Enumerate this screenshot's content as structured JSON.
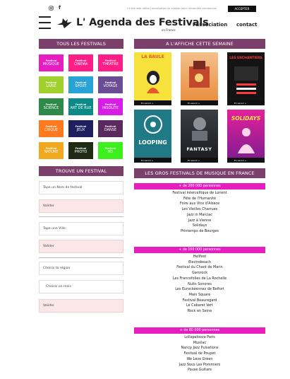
{
  "topbar": {
    "social_icons": [
      "instagram-icon",
      "facebook-icon"
    ],
    "cookie_text": "Ce site web utilise l'autorisation de cookies pour l'ensemble commercial",
    "accept_label": "ACCEPTER"
  },
  "header": {
    "logo_text": "L' Agenda des Festivals",
    "logo_sub": "en France",
    "nav_association": "l'association",
    "nav_contact": "contact"
  },
  "sections": {
    "all_festivals": "TOUS LES FESTIVALS",
    "affiche": "A L'AFFICHE CETTE SEMAINE",
    "find": "TROUVE UN FESTIVAL",
    "gros": "LES GROS FESTIVALS DE MUSIQUE EN FRANCE"
  },
  "categories": [
    {
      "kicker": "Festival",
      "label": "MUSIQUE",
      "color": "#e61ebf"
    },
    {
      "kicker": "Festival",
      "label": "CINEMA",
      "color": "#ff1e88"
    },
    {
      "kicker": "Festival",
      "label": "THEATRE",
      "color": "#ff1e88"
    },
    {
      "kicker": "Festival",
      "label": "LIVRE",
      "color": "#9fd02b"
    },
    {
      "kicker": "Festival",
      "label": "SPORT",
      "color": "#29a3d6"
    },
    {
      "kicker": "Festival",
      "label": "VOYAGE",
      "color": "#6a4c92"
    },
    {
      "kicker": "Festival",
      "label": "SCIENCE",
      "color": "#2f8a4a"
    },
    {
      "kicker": "Festival",
      "label": "ART DE RUE",
      "color": "#0b8a87"
    },
    {
      "kicker": "Festival",
      "label": "INSOLITE",
      "color": "#d81ee6"
    },
    {
      "kicker": "Festival",
      "label": "CIRQUE",
      "color": "#ff7a1e"
    },
    {
      "kicker": "Festival",
      "label": "JEUX",
      "color": "#1d1f5e"
    },
    {
      "kicker": "Festival",
      "label": "DANSE",
      "color": "#5a2a5f"
    },
    {
      "kicker": "Festival",
      "label": "NATURE",
      "color": "#f0a81e"
    },
    {
      "kicker": "Festival",
      "label": "PHOTO",
      "color": "#1f2b14"
    },
    {
      "kicker": "Festival",
      "label": "BD",
      "color": "#3cf01e"
    }
  ],
  "search": {
    "name_placeholder": "Tape un Nom de festival",
    "validate1": "Valider",
    "city_placeholder": "Tape une Ville",
    "validate2": "Valider",
    "region": "Choisis ta région",
    "month": "Choisis un mois",
    "validate3": "Valider"
  },
  "posters": [
    {
      "title": "LA BAULE",
      "bar": "En savoir +"
    },
    {
      "title": "",
      "bar": "En savoir +"
    },
    {
      "title": "LES ENCHANTIERS",
      "bar": "En savoir +"
    },
    {
      "title": "LOOPING",
      "bar": "En savoir +"
    },
    {
      "title": "FANTASY",
      "bar": "En savoir +"
    },
    {
      "title": "SOLIDAYS",
      "bar": "En savoir +"
    }
  ],
  "tiers": [
    {
      "label": "+ de 200 000 personnes",
      "festivals": [
        "Festival Interceltique de Lorient",
        "Fête de l'Humanité",
        "Foire aux Vins d'Alsace",
        "Les Vieilles Charrues",
        "Jazz in Marciac",
        "Jazz à Vienne",
        "Solidays",
        "Printemps de Bourges"
      ]
    },
    {
      "label": "+ de 100 000 personnes",
      "festivals": [
        "Hellfest",
        "Electrobeach",
        "Festival du Chant de Marin",
        "Garorock",
        "Les Francofolies de La Rochelle",
        "Nuits Sonores",
        "Les Eurockéennes de Belfort",
        "Main Square",
        "Festival Beauregard",
        "Le Cabaret Vert",
        "Rock en Seine"
      ]
    },
    {
      "label": "+ de 80 000 personnes",
      "festivals": [
        "Lollapalooza Paris",
        "Musilac",
        "Nancy Jazz Pulsations",
        "Festival de Poupet",
        "We Love Green",
        "Jazz Sous Les Pommiers",
        "Pause Guitare"
      ]
    }
  ]
}
